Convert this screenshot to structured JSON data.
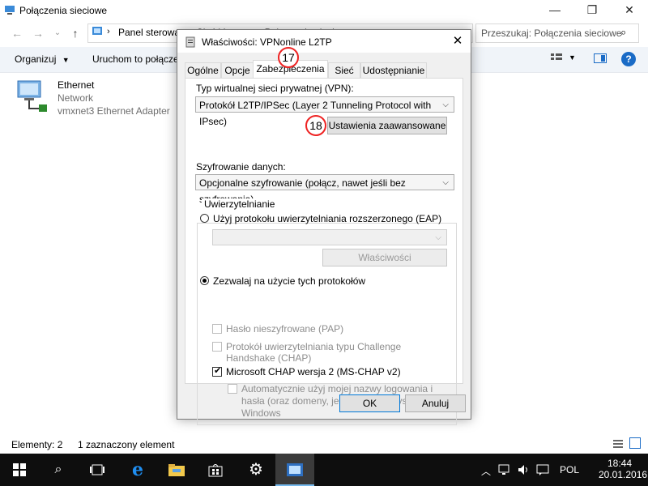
{
  "explorer": {
    "title": "Połączenia sieciowe",
    "address": "Panel sterowa... › Sieć i Internet › Połączenia sieciowe",
    "search_placeholder": "Przeszukaj: Połączenia sieciowe",
    "toolbar": {
      "organize": "Organizuj",
      "start": "Uruchom to połączenie"
    },
    "item": {
      "name": "Ethernet",
      "type": "Network",
      "adapter": "vmxnet3 Ethernet Adapter"
    },
    "status": {
      "elements": "Elementy: 2",
      "selected": "1 zaznaczony element"
    }
  },
  "dialog": {
    "title": "Właściwości: VPNonline L2TP",
    "close": "✕",
    "tabs": [
      "Ogólne",
      "Opcje",
      "Zabezpieczenia",
      "Sieć",
      "Udostępnianie"
    ],
    "active_tab": "Zabezpieczenia",
    "vpn_type_label": "Typ wirtualnej sieci prywatnej (VPN):",
    "vpn_type_value": "Protokół L2TP/IPSec (Layer 2 Tunneling Protocol with IPsec)",
    "advanced_button": "Ustawienia zaawansowane",
    "encryption_label": "Szyfrowanie danych:",
    "encryption_value": "Opcjonalne szyfrowanie (połącz, nawet jeśli bez szyfrowania)",
    "auth_group": "Uwierzytelnianie",
    "radio_eap": "Użyj protokołu uwierzytelniania rozszerzonego (EAP)",
    "properties_button": "Właściwości",
    "radio_allow": "Zezwalaj na użycie tych protokołów",
    "chk_pap": "Hasło nieszyfrowane (PAP)",
    "chk_chap": "Protokół uwierzytelniania typu Challenge Handshake (CHAP)",
    "chk_mschap": "Microsoft CHAP wersja 2 (MS-CHAP v2)",
    "chk_auto": "Automatycznie użyj mojej nazwy logowania i hasła (oraz domeny, jeżeli istnieje) systemu Windows",
    "ok": "OK",
    "cancel": "Anuluj",
    "callout_17": "17",
    "callout_18": "18"
  },
  "taskbar": {
    "language": "POL",
    "time": "18:44",
    "date": "20.01.2016"
  },
  "colors": {
    "accent": "#0078d7",
    "callout": "#ee2222",
    "taskbar": "#0e0e0e",
    "toolbar": "#f0f4f9"
  }
}
